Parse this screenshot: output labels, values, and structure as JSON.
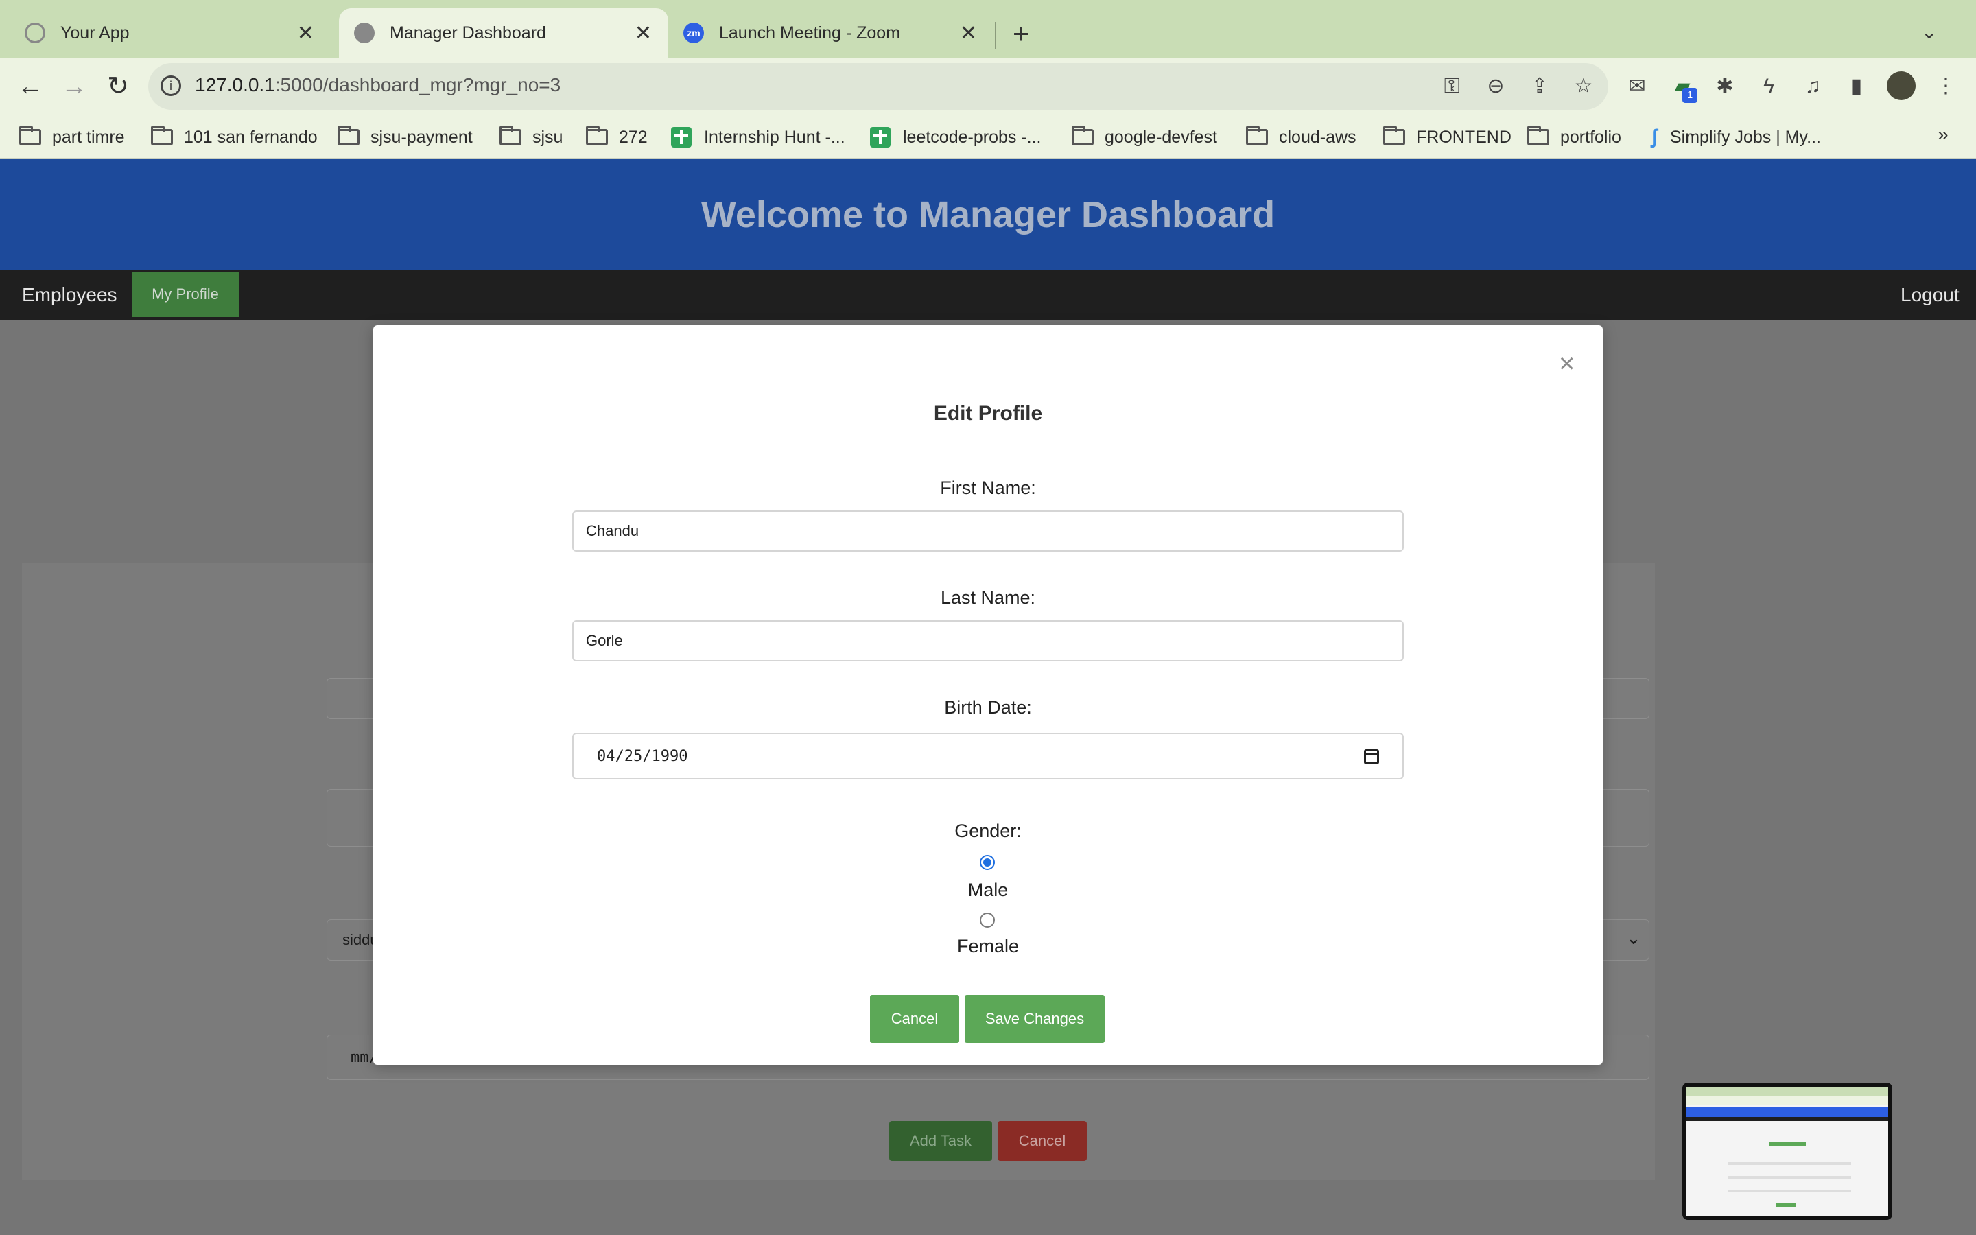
{
  "browser": {
    "tabs": [
      {
        "title": "Your App",
        "active": false
      },
      {
        "title": "Manager Dashboard",
        "active": true
      },
      {
        "title": "Launch Meeting - Zoom",
        "active": false,
        "icon_text": "zm"
      }
    ],
    "url_host": "127.0.0.1",
    "url_rest": ":5000/dashboard_mgr?mgr_no=3",
    "bookmarks": [
      {
        "label": "part timre",
        "icon": "folder-icon"
      },
      {
        "label": "101 san fernando",
        "icon": "folder-icon"
      },
      {
        "label": "sjsu-payment",
        "icon": "folder-icon"
      },
      {
        "label": "sjsu",
        "icon": "folder-icon"
      },
      {
        "label": "272",
        "icon": "folder-icon"
      },
      {
        "label": "Internship Hunt -...",
        "icon": "sheets-icon"
      },
      {
        "label": "leetcode-probs -...",
        "icon": "sheets-icon"
      },
      {
        "label": "google-devfest",
        "icon": "folder-icon"
      },
      {
        "label": "cloud-aws",
        "icon": "folder-icon"
      },
      {
        "label": "FRONTEND",
        "icon": "folder-icon"
      },
      {
        "label": "portfolio",
        "icon": "folder-icon"
      },
      {
        "label": "Simplify Jobs | My...",
        "icon": "simplify-icon"
      }
    ],
    "extension_badge": "1"
  },
  "page": {
    "header_title": "Welcome to Manager Dashboard",
    "nav": {
      "employees": "Employees",
      "my_profile": "My Profile",
      "logout": "Logout"
    },
    "background_form": {
      "select_partial": "siddu",
      "date_partial": "mm/",
      "add_task": "Add Task",
      "cancel": "Cancel"
    }
  },
  "modal": {
    "title": "Edit Profile",
    "close_symbol": "×",
    "first_name_label": "First Name:",
    "first_name_value": "Chandu",
    "last_name_label": "Last Name:",
    "last_name_value": "Gorle",
    "birth_date_label": "Birth Date:",
    "birth_date_value": "04/25/1990",
    "gender_label": "Gender:",
    "gender_options": [
      {
        "label": "Male",
        "selected": true
      },
      {
        "label": "Female",
        "selected": false
      }
    ],
    "cancel_label": "Cancel",
    "save_label": "Save Changes"
  },
  "colors": {
    "header_blue": "#1d4a9b",
    "nav_dark": "#1f1f1f",
    "button_green": "#5ca857",
    "cancel_red": "#8a2b25"
  }
}
